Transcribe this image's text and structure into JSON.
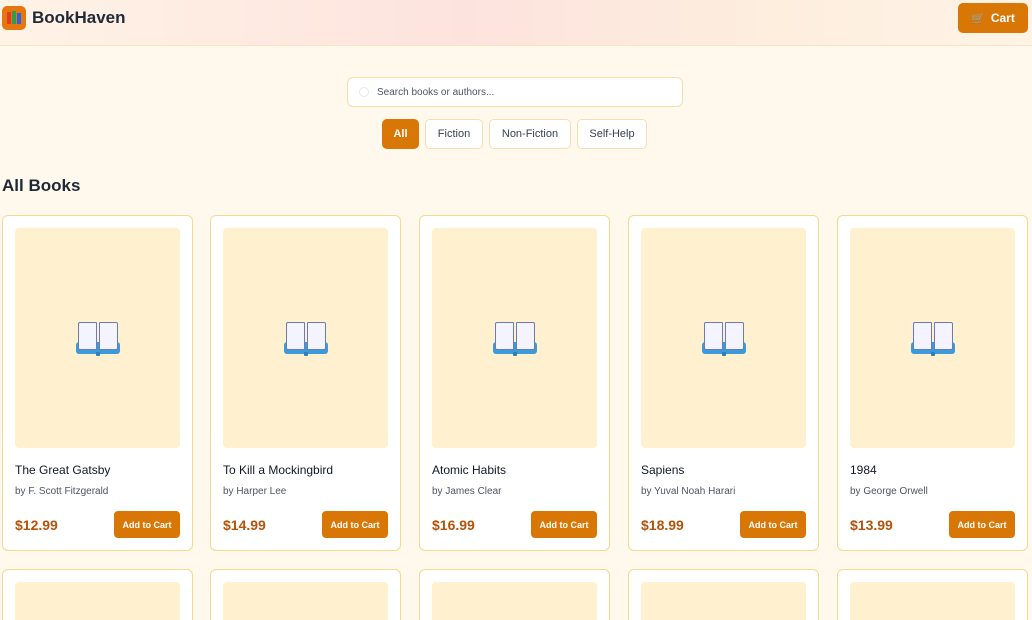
{
  "header": {
    "brand": "BookHaven",
    "cart_label": "Cart"
  },
  "search": {
    "placeholder": "Search books or authors...",
    "value": ""
  },
  "filters": [
    "All",
    "Fiction",
    "Non-Fiction",
    "Self-Help"
  ],
  "active_filter": "All",
  "section_title": "All Books",
  "add_button_label": "Add to Cart",
  "books": [
    {
      "title": "The Great Gatsby",
      "author": "by F. Scott Fitzgerald",
      "price": "$12.99"
    },
    {
      "title": "To Kill a Mockingbird",
      "author": "by Harper Lee",
      "price": "$14.99"
    },
    {
      "title": "Atomic Habits",
      "author": "by James Clear",
      "price": "$16.99"
    },
    {
      "title": "Sapiens",
      "author": "by Yuval Noah Harari",
      "price": "$18.99"
    },
    {
      "title": "1984",
      "author": "by George Orwell",
      "price": "$13.99"
    }
  ],
  "icons": {
    "logo": "books-logo-icon",
    "cart": "shopping-cart-icon",
    "search": "search-icon",
    "cover": "open-book-icon"
  },
  "colors": {
    "accent": "#d97706",
    "price": "#b45309",
    "card_border": "#f6d98f",
    "cover": "#fff0cf"
  }
}
